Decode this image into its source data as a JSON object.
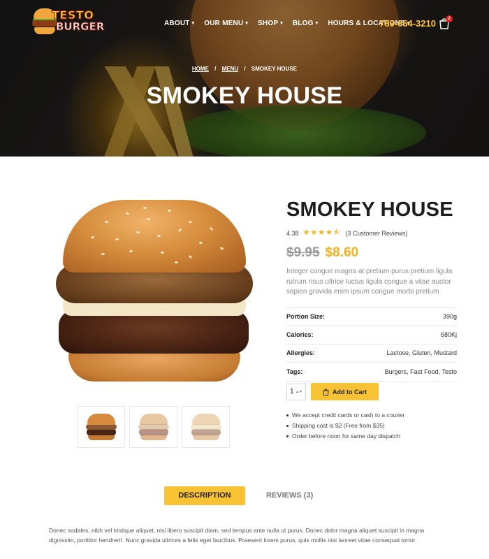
{
  "header": {
    "logo": {
      "line1": "TESTO",
      "line2": "BURGER"
    },
    "nav": [
      {
        "label": "ABOUT"
      },
      {
        "label": "OUR MENU"
      },
      {
        "label": "SHOP"
      },
      {
        "label": "BLOG"
      },
      {
        "label": "HOURS & LOCATIONS"
      }
    ],
    "phone": "789-654-3210",
    "cart_count": "2"
  },
  "breadcrumb": {
    "home": "HOME",
    "menu": "MENU",
    "current": "SMOKEY HOUSE",
    "separator": "/"
  },
  "hero_title": "SMOKEY HOUSE",
  "product": {
    "title": "SMOKEY HOUSE",
    "rating": "4.38",
    "stars": "★★★★⯪",
    "reviews": "(3 Customer Reviews)",
    "old_price": "$9.95",
    "price": "$8.60",
    "description": "Integer congue magna at pretium purus pretium ligula rutrum risus ultrice luctus ligula congue a vitae auctor sapien gravida enim ipsum congue morbi pretium",
    "specs": [
      {
        "label": "Portion Size:",
        "value": "390g"
      },
      {
        "label": "Calories:",
        "value": "680Kj"
      },
      {
        "label": "Allergies:",
        "value": "Lactose, Gluten, Mustard"
      },
      {
        "label": "Tags:",
        "value": "Burgers, Fast Food, Testo"
      }
    ],
    "quantity": "1",
    "add_to_cart": "Add to Cart",
    "notes": [
      "We accept credit cards or cash to a courier",
      "Shipping cost is $2 (Free from $35)",
      "Order before noon for same day dispatch"
    ]
  },
  "tabs": {
    "description": "DESCRIPTION",
    "reviews": "REVIEWS (3)"
  },
  "description_text": "Donec sodales, nibh vel tristique aliquet, nisi libero suscipit diam, sed tempus ante nulla ut purus. Donec dolor magna aliquet suscipit in magna dignissim, porttitor hendrerit. Nunc gravida ultrices a felis eget faucibus. Praesent lorem purus, quis mollis nisi laoreet vitae consequat tortor",
  "colors": {
    "accent": "#f7c233",
    "price": "#f3b21c",
    "badge": "#e21d1d"
  }
}
